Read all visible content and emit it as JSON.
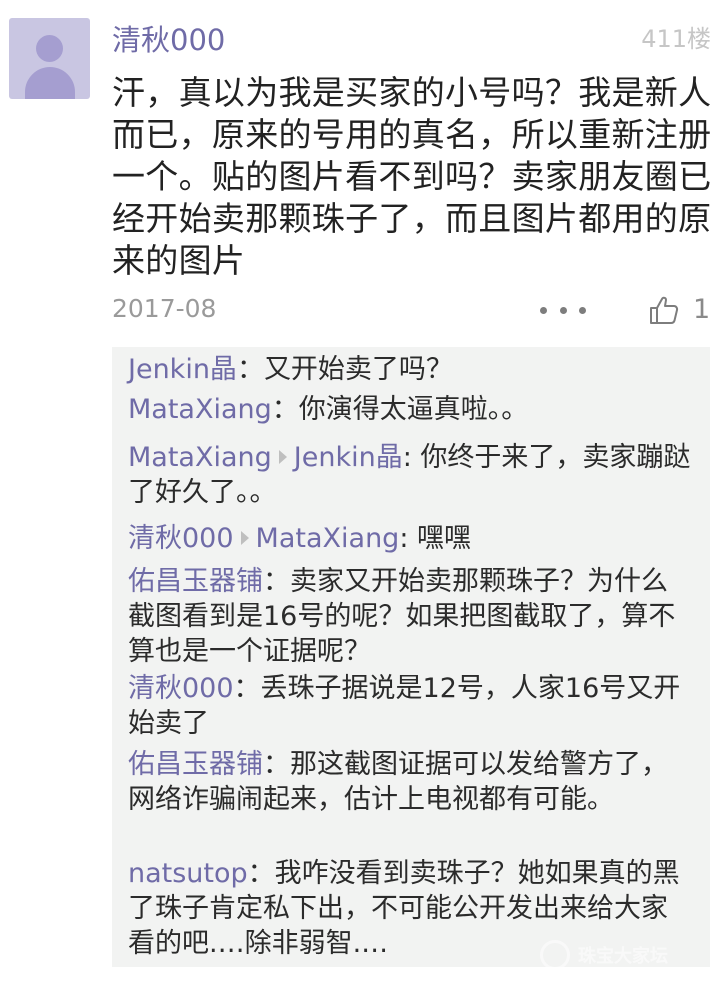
{
  "post": {
    "username": "清秋000",
    "floor": "411楼",
    "content": "汗，真以为我是买家的小号吗？我是新人而已，原来的号用的真名，所以重新注册一个。贴的图片看不到吗？卖家朋友圈已经开始卖那颗珠子了，而且图片都用的原来的图片",
    "date": "2017-08",
    "like_count": "1"
  },
  "replies": [
    {
      "author": "Jenkin晶",
      "reply_to": "",
      "separator": "：",
      "text": "又开始卖了吗？"
    },
    {
      "author": "MataXiang",
      "reply_to": "",
      "separator": "：",
      "text": "你演得太逼真啦。。"
    },
    {
      "author": "MataXiang",
      "reply_to": "Jenkin晶",
      "separator": ":",
      "text": " 你终于来了，卖家蹦跶了好久了。。"
    },
    {
      "author": "清秋000",
      "reply_to": "MataXiang",
      "separator": ":",
      "text": " 嘿嘿"
    },
    {
      "author": "佑昌玉器铺",
      "reply_to": "",
      "separator": "：",
      "text": "卖家又开始卖那颗珠子？为什么截图看到是16号的呢？如果把图截取了，算不算也是一个证据呢？"
    },
    {
      "author": "清秋000",
      "reply_to": "",
      "separator": "：",
      "text": "丢珠子据说是12号，人家16号又开始卖了"
    },
    {
      "author": "佑昌玉器铺",
      "reply_to": "",
      "separator": "：",
      "text": "那这截图证据可以发给警方了，网络诈骗闹起来，估计上电视都有可能。"
    },
    {
      "author": "natsutop",
      "reply_to": "",
      "separator": "：",
      "text": "我咋没看到卖珠子？她如果真的黑了珠子肯定私下出，不可能公开发出来给大家看的吧.…除非弱智.…"
    }
  ],
  "watermark": {
    "text": "珠宝大家坛"
  },
  "icons": {
    "avatar": "default-user-avatar-icon",
    "more": "more-dots-icon",
    "like": "thumbs-up-icon"
  },
  "colors": {
    "username": "#6f6ba7",
    "reply_background": "#f2f3f2",
    "avatar_background": "#c9c6e2"
  }
}
